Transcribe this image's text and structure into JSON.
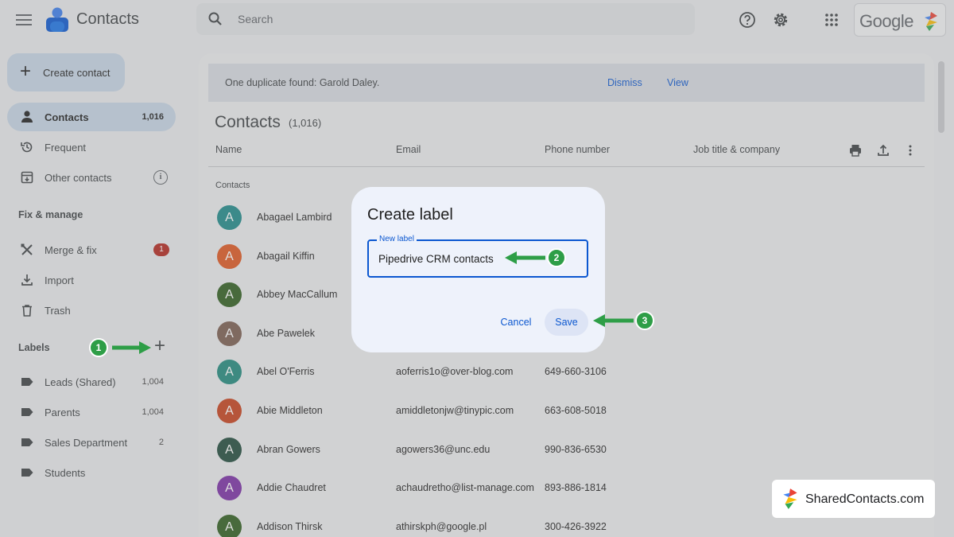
{
  "app": {
    "title": "Contacts"
  },
  "search": {
    "placeholder": "Search"
  },
  "brand_logo_text": "Google",
  "sidebar": {
    "create_label": "Create contact",
    "nav": [
      {
        "label": "Contacts",
        "count": "1,016",
        "icon": "person-icon",
        "active": true
      },
      {
        "label": "Frequent",
        "count": "",
        "icon": "history-icon"
      },
      {
        "label": "Other contacts",
        "count": "",
        "icon": "archive-icon"
      }
    ],
    "fix_heading": "Fix & manage",
    "fix_items": [
      {
        "label": "Merge & fix",
        "badge": "1",
        "icon": "merge-icon"
      },
      {
        "label": "Import",
        "icon": "download-icon"
      },
      {
        "label": "Trash",
        "icon": "trash-icon"
      }
    ],
    "labels_heading": "Labels",
    "labels": [
      {
        "label": "Leads (Shared)",
        "count": "1,004"
      },
      {
        "label": "Parents",
        "count": "1,004"
      },
      {
        "label": "Sales Department",
        "count": "2"
      },
      {
        "label": "Students",
        "count": ""
      }
    ]
  },
  "banner": {
    "message": "One duplicate found: Garold Daley.",
    "dismiss": "Dismiss",
    "view": "View"
  },
  "main": {
    "title": "Contacts",
    "count": "(1,016)",
    "columns": [
      "Name",
      "Email",
      "Phone number",
      "Job title & company"
    ],
    "group_label": "Contacts",
    "rows": [
      {
        "initial": "A",
        "color": "#1e8a8a",
        "name": "Abagael Lambird",
        "email": "",
        "phone": ""
      },
      {
        "initial": "A",
        "color": "#e0561f",
        "name": "Abagail Kiffin",
        "email": "",
        "phone": ""
      },
      {
        "initial": "A",
        "color": "#2f5e1e",
        "name": "Abbey MacCallum",
        "email": "",
        "phone": ""
      },
      {
        "initial": "A",
        "color": "#7b5d50",
        "name": "Abe Pawelek",
        "email": "",
        "phone": ""
      },
      {
        "initial": "A",
        "color": "#218a7d",
        "name": "Abel O'Ferris",
        "email": "aoferris1o@over-blog.com",
        "phone": "649-660-3106"
      },
      {
        "initial": "A",
        "color": "#c7401b",
        "name": "Abie Middleton",
        "email": "amiddletonjw@tinypic.com",
        "phone": "663-608-5018"
      },
      {
        "initial": "A",
        "color": "#1f4a3b",
        "name": "Abran Gowers",
        "email": "agowers36@unc.edu",
        "phone": "990-836-6530"
      },
      {
        "initial": "A",
        "color": "#7a2ea6",
        "name": "Addie Chaudret",
        "email": "achaudretho@list-manage.com",
        "phone": "893-886-1814"
      },
      {
        "initial": "A",
        "color": "#2f5e1e",
        "name": "Addison Thirsk",
        "email": "athirskph@google.pl",
        "phone": "300-426-3922"
      }
    ]
  },
  "dialog": {
    "title": "Create label",
    "field_label": "New label",
    "field_value": "Pipedrive CRM contacts",
    "cancel": "Cancel",
    "save": "Save"
  },
  "annotations": {
    "step1": "1",
    "step2": "2",
    "step3": "3",
    "accent": "#2e9e47"
  },
  "watermark": {
    "text": "SharedContacts.com"
  }
}
